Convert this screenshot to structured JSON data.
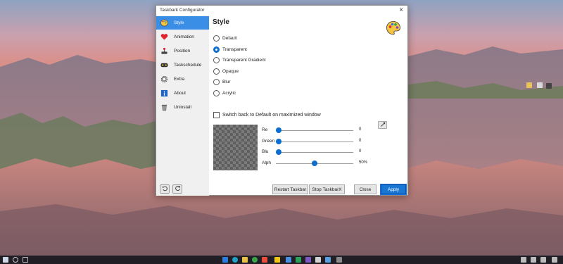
{
  "window": {
    "title": "Taskbark Configurator",
    "close_glyph": "×"
  },
  "sidebar": {
    "items": [
      {
        "label": "Style",
        "icon": "palette-icon",
        "active": true
      },
      {
        "label": "Animation",
        "icon": "heart-icon",
        "active": false
      },
      {
        "label": "Position",
        "icon": "joystick-icon",
        "active": false
      },
      {
        "label": "Taskschedule",
        "icon": "schedule-icon",
        "active": false
      },
      {
        "label": "Extra",
        "icon": "gear-icon",
        "active": false
      },
      {
        "label": "About",
        "icon": "info-icon",
        "active": false
      },
      {
        "label": "Uninstall",
        "icon": "trash-icon",
        "active": false
      }
    ],
    "bottom_buttons": [
      "undo-icon",
      "refresh-icon"
    ]
  },
  "content": {
    "heading": "Style",
    "styles": [
      {
        "label": "Default",
        "selected": false
      },
      {
        "label": "Transparent",
        "selected": true
      },
      {
        "label": "Transparent Gradient",
        "selected": false
      },
      {
        "label": "Opaque",
        "selected": false
      },
      {
        "label": "Blur",
        "selected": false
      },
      {
        "label": "Acrylic",
        "selected": false
      }
    ],
    "switch_back_label": "Switch back to Default on maximized window",
    "switch_back_checked": false,
    "sliders": [
      {
        "label": "Re",
        "value": "0",
        "fraction": 0.0
      },
      {
        "label": "Green",
        "value": "0",
        "fraction": 0.0
      },
      {
        "label": "Blu",
        "value": "0",
        "fraction": 0.0
      },
      {
        "label": "Alph",
        "value": "50%",
        "fraction": 0.5
      }
    ]
  },
  "footer": {
    "restart": "Restart Taskbar",
    "stop": "Stop TaskbarX",
    "close": "Close",
    "apply": "Apply"
  },
  "colors": {
    "accent": "#3a8ee6",
    "apply_bg": "#1976d2",
    "slider_thumb": "#0a6ed1",
    "sidebar_bg": "#f0f0f0"
  }
}
